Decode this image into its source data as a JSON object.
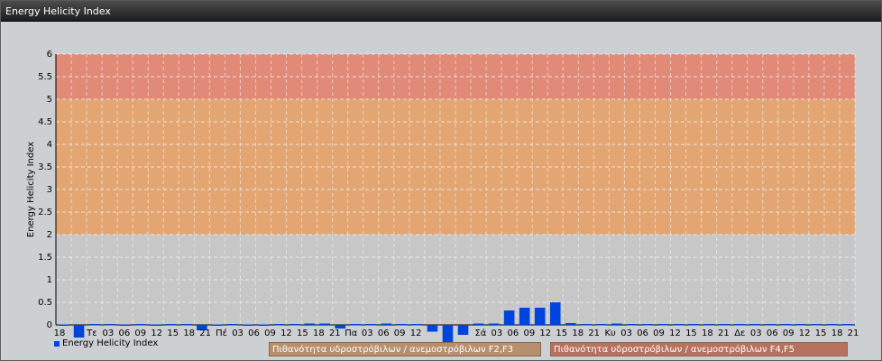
{
  "window": {
    "title": "Energy Helicity Index"
  },
  "legend": {
    "series_label": "Energy Helicity Index",
    "band_f2f3": "Πιθανότητα υδροστρόβιλων / ανεμοστρόβιλων F2,F3",
    "band_f4f5": "Πιθανότητα υδροστρόβιλων / ανεμοστρόβιλων F4,F5"
  },
  "colors": {
    "bar": "#0044dd",
    "band_low": "#c7c7c7",
    "band_mid": "#e3a673",
    "band_high": "#e28a78"
  },
  "chart_data": {
    "type": "bar",
    "title": "",
    "ylabel": "Energy Helicity Index",
    "xlabel": "",
    "ylim": [
      0,
      6
    ],
    "yticks": [
      "0",
      "0.5",
      "1",
      "1.5",
      "2",
      "2.5",
      "3",
      "3.5",
      "4",
      "4.5",
      "5",
      "5.5",
      "6"
    ],
    "bands": [
      {
        "from": 0,
        "to": 2,
        "color": "#c7c7c7"
      },
      {
        "from": 2,
        "to": 5,
        "color": "#e3a673"
      },
      {
        "from": 5,
        "to": 6,
        "color": "#e28a78"
      }
    ],
    "grid": true,
    "categories": [
      "18",
      "",
      "Τε",
      "03",
      "06",
      "09",
      "12",
      "15",
      "18",
      "21",
      "Πέ",
      "03",
      "06",
      "09",
      "12",
      "15",
      "18",
      "21",
      "Πα",
      "03",
      "06",
      "09",
      "12",
      "",
      "",
      "",
      "Σά",
      "03",
      "06",
      "09",
      "12",
      "15",
      "18",
      "21",
      "Κυ",
      "03",
      "06",
      "09",
      "12",
      "15",
      "18",
      "21",
      "Δε",
      "03",
      "06",
      "09",
      "12",
      "15",
      "18",
      "21"
    ],
    "series": [
      {
        "name": "Energy Helicity Index",
        "values": [
          0.01,
          -0.28,
          0.02,
          0.02,
          0.01,
          0.02,
          0.01,
          0.02,
          0.02,
          -0.12,
          0.01,
          0.02,
          0.01,
          0.01,
          0.02,
          0.02,
          0.03,
          0.03,
          -0.08,
          0.02,
          0.02,
          0.03,
          0.02,
          0.02,
          -0.15,
          -0.38,
          -0.22,
          0.03,
          0.03,
          0.32,
          0.38,
          0.38,
          0.5,
          0.04,
          0.02,
          0.02,
          0.03,
          0.02,
          0.02,
          0.02,
          0.02,
          0.02,
          0.02,
          0.02,
          0.02,
          0.02,
          0.02,
          0.02,
          0.02,
          0.02,
          0.02,
          0.02
        ]
      }
    ]
  }
}
